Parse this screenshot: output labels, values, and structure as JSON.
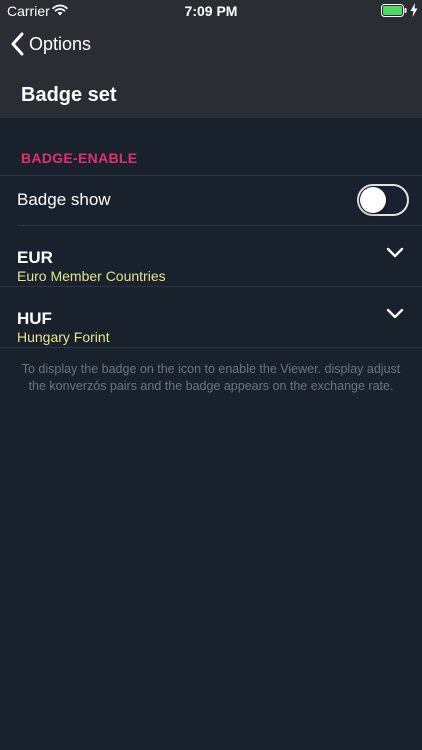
{
  "status_bar": {
    "carrier": "Carrier",
    "time": "7:09 PM",
    "battery_color": "#4cd964"
  },
  "nav": {
    "back_label": "Options",
    "title": "Badge set"
  },
  "section": {
    "header": "BADGE-ENABLE"
  },
  "badge_toggle": {
    "label": "Badge show",
    "on": false
  },
  "currencies": [
    {
      "code": "EUR",
      "name": "Euro Member Countries"
    },
    {
      "code": "HUF",
      "name": "Hungary Forint"
    }
  ],
  "info": {
    "text": "To display the badge on the icon to enable the Viewer. display adjust the konverzós pairs and the badge appears on the exchange rate."
  },
  "colors": {
    "background": "#19212d",
    "header": "#2a2d33",
    "accent": "#e0306d",
    "subtitle": "#e5e58a",
    "muted_text": "#6a7380"
  },
  "icons": [
    "wifi-icon",
    "battery-icon",
    "charging-bolt-icon",
    "back-chevron-icon",
    "chevron-down-icon"
  ]
}
